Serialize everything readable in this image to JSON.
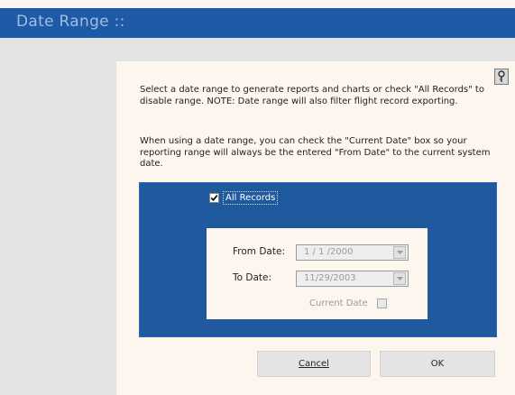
{
  "window": {
    "title": "Date Range ::"
  },
  "instructions": {
    "paragraph1": "Select a date range to generate reports and charts or check \"All Records\" to disable range. NOTE: Date range will also filter flight record exporting.",
    "paragraph2": "When using a date range, you can check the \"Current Date\" box so your reporting range will always be the entered \"From Date\" to the current system date."
  },
  "all_records": {
    "label": "All Records",
    "checked": true
  },
  "date_range": {
    "from_label": "From Date:",
    "from_value": "1 / 1 /2000",
    "to_label": "To Date:",
    "to_value": "11/29/2003",
    "current_date_label": "Current Date",
    "current_date_checked": false,
    "enabled": false
  },
  "buttons": {
    "cancel": "Cancel",
    "ok": "OK"
  },
  "help_icon": "help-icon",
  "colors": {
    "title_bar": "#1f5aa6",
    "title_text": "#9fbde4",
    "panel_blue": "#21599e",
    "background": "#fdf6ee",
    "side_panel": "#e3e3e3"
  }
}
